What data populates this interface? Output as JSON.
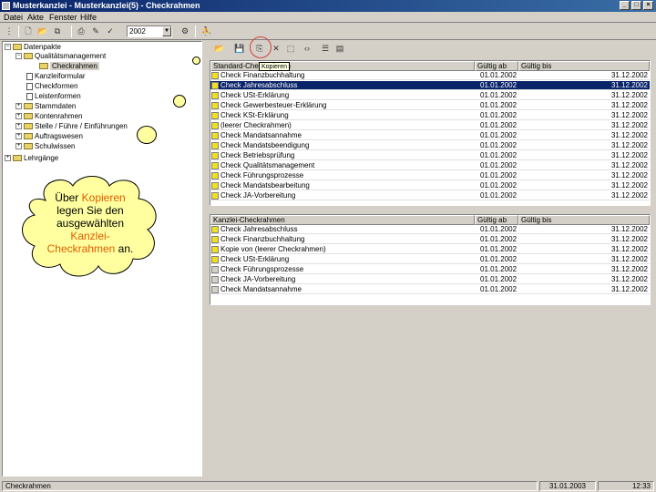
{
  "window": {
    "title": "Musterkanzlei - Musterkanzlei(5) - Checkrahmen",
    "buttons": [
      "_",
      "□",
      "×"
    ]
  },
  "menu": [
    "Datei",
    "Akte",
    "Fenster",
    "Hilfe"
  ],
  "toolbar": {
    "year": "2002"
  },
  "tree": {
    "nodes": [
      {
        "label": "Datenpakte"
      },
      {
        "label": "Qualitätsmanagement"
      },
      {
        "label": "Checkrahmen"
      },
      {
        "label": "Kanzleiformular"
      },
      {
        "label": "Checkformen"
      },
      {
        "label": "Leistenformen"
      },
      {
        "label": "Stammdaten"
      },
      {
        "label": "Kontenrahmen"
      },
      {
        "label": "Stelle / Führe / Einführungen"
      },
      {
        "label": "Auftragswesen"
      },
      {
        "label": "Schulwissen"
      },
      {
        "label": "Lehrgänge"
      }
    ]
  },
  "tooltip": "Kopieren",
  "grid1": {
    "headers": [
      "Standard-Checkrahmen",
      "Gültig ab",
      "Gültig bis"
    ],
    "rows": [
      {
        "name": "Check Finanzbuchhaltung",
        "from": "01.01.2002",
        "to": "31.12.2002",
        "mark": "y",
        "selected": false
      },
      {
        "name": "Check Jahresabschluss",
        "from": "01.01.2002",
        "to": "31.12.2002",
        "mark": "y",
        "selected": true
      },
      {
        "name": "Check USt-Erklärung",
        "from": "01.01.2002",
        "to": "31.12.2002",
        "mark": "y",
        "selected": false
      },
      {
        "name": "Check Gewerbesteuer-Erklärung",
        "from": "01.01.2002",
        "to": "31.12.2002",
        "mark": "y",
        "selected": false
      },
      {
        "name": "Check KSt-Erklärung",
        "from": "01.01.2002",
        "to": "31.12.2002",
        "mark": "y",
        "selected": false
      },
      {
        "name": "(leerer Checkrahmen)",
        "from": "01.01.2002",
        "to": "31.12.2002",
        "mark": "y",
        "selected": false
      },
      {
        "name": "Check Mandatsannahme",
        "from": "01.01.2002",
        "to": "31.12.2002",
        "mark": "y",
        "selected": false
      },
      {
        "name": "Check Mandatsbeendigung",
        "from": "01.01.2002",
        "to": "31.12.2002",
        "mark": "y",
        "selected": false
      },
      {
        "name": "Check Betriebsprüfung",
        "from": "01.01.2002",
        "to": "31.12.2002",
        "mark": "y",
        "selected": false
      },
      {
        "name": "Check Qualitätsmanagement",
        "from": "01.01.2002",
        "to": "31.12.2002",
        "mark": "y",
        "selected": false
      },
      {
        "name": "Check Führungsprozesse",
        "from": "01.01.2002",
        "to": "31.12.2002",
        "mark": "y",
        "selected": false
      },
      {
        "name": "Check Mandatsbearbeitung",
        "from": "01.01.2002",
        "to": "31.12.2002",
        "mark": "y",
        "selected": false
      },
      {
        "name": "Check JA-Vorbereitung",
        "from": "01.01.2002",
        "to": "31.12.2002",
        "mark": "y",
        "selected": false
      }
    ]
  },
  "grid2": {
    "headers": [
      "Kanzlei-Checkrahmen",
      "Gültig ab",
      "Gültig bis"
    ],
    "rows": [
      {
        "name": "Check Jahresabschluss",
        "from": "01.01.2002",
        "to": "31.12.2002",
        "mark": "y"
      },
      {
        "name": "Check Finanzbuchhaltung",
        "from": "01.01.2002",
        "to": "31.12.2002",
        "mark": "y"
      },
      {
        "name": "Kopie von (leerer Checkrahmen)",
        "from": "01.01.2002",
        "to": "31.12.2002",
        "mark": "y"
      },
      {
        "name": "Check USt-Erklärung",
        "from": "01.01.2002",
        "to": "31.12.2002",
        "mark": "y"
      },
      {
        "name": "Check Führungsprozesse",
        "from": "01.01.2002",
        "to": "31.12.2002",
        "mark": "n"
      },
      {
        "name": "Check JA-Vorbereitung",
        "from": "01.01.2002",
        "to": "31.12.2002",
        "mark": "n"
      },
      {
        "name": "Check Mandatsannahme",
        "from": "01.01.2002",
        "to": "31.12.2002",
        "mark": "n"
      }
    ]
  },
  "status": {
    "left": "Checkrahmen",
    "date": "31.01.2003",
    "time": "12:33"
  },
  "callout": {
    "line1_a": "Über ",
    "line1_b": "Kopieren",
    "line2": "legen Sie den",
    "line3": "ausgewählten",
    "line4": "Kanzlei-",
    "line5_a": "Checkrahmen",
    "line5_b": " an.",
    "highlight_color": "#e05a00",
    "fill_color": "#ffffa0"
  }
}
